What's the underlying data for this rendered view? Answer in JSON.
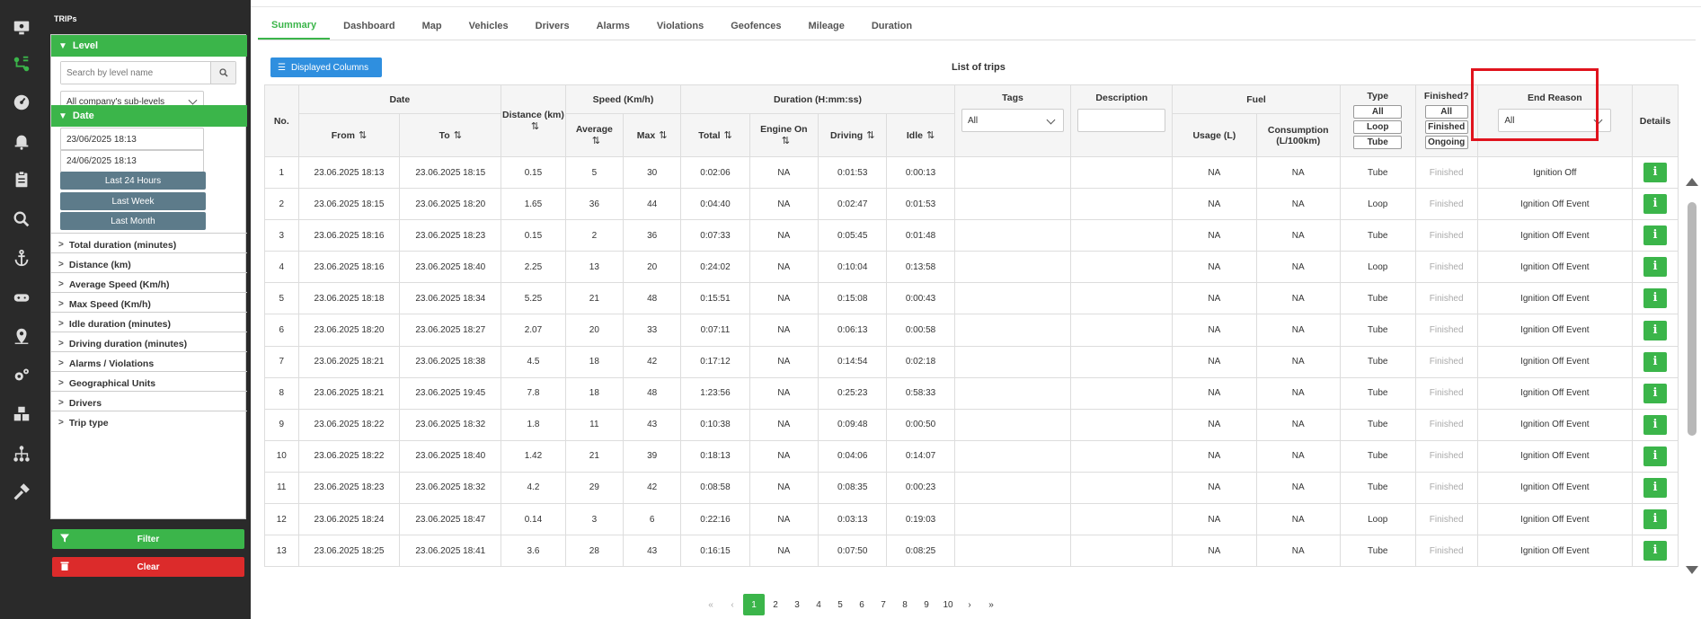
{
  "sidebar": {
    "icons": [
      "monitor-icon",
      "trips-route-icon",
      "dashboard-gauge-icon",
      "alarm-bell-icon",
      "clipboard-icon",
      "search-icon",
      "anchor-icon",
      "gamepad-icon",
      "location-pin-icon",
      "settings-gears-icon",
      "cubes-icon",
      "network-icon",
      "hammer-icon"
    ]
  },
  "panel": {
    "title": "TRIPs",
    "level_label": "Level",
    "search_placeholder": "Search by level name",
    "sublevel_select": "All company's sub-levels",
    "date_label": "Date",
    "date_from": "23/06/2025 18:13",
    "date_to": "24/06/2025 18:13",
    "quick": [
      "Last 24 Hours",
      "Last Week",
      "Last Month"
    ],
    "collapsed": [
      "Total duration (minutes)",
      "Distance (km)",
      "Average Speed (Km/h)",
      "Max Speed (Km/h)",
      "Idle duration (minutes)",
      "Driving duration (minutes)",
      "Alarms / Violations",
      "Geographical Units",
      "Drivers",
      "Trip type"
    ],
    "filter_label": "Filter",
    "clear_label": "Clear"
  },
  "tabs": [
    "Summary",
    "Dashboard",
    "Map",
    "Vehicles",
    "Drivers",
    "Alarms",
    "Violations",
    "Geofences",
    "Mileage",
    "Duration"
  ],
  "displayed_columns": "Displayed Columns",
  "list_title": "List of trips",
  "headers": {
    "no": "No.",
    "date": "Date",
    "from": "From",
    "to": "To",
    "distance": "Distance (km)",
    "speed": "Speed (Km/h)",
    "average": "Average",
    "max": "Max",
    "duration": "Duration (H:mm:ss)",
    "total": "Total",
    "engine_on": "Engine On",
    "driving": "Driving",
    "idle": "Idle",
    "tags": "Tags",
    "tags_select": "All",
    "description": "Description",
    "fuel": "Fuel",
    "usage": "Usage (L)",
    "consumption": "Consumption (L/100km)",
    "type": "Type",
    "type_opts": [
      "All",
      "Loop",
      "Tube"
    ],
    "finished": "Finished?",
    "finished_opts": [
      "All",
      "Finished",
      "Ongoing"
    ],
    "end_reason": "End Reason",
    "end_reason_select": "All",
    "details": "Details",
    "sort_glyph": "⇅",
    "info_glyph": "i"
  },
  "rows": [
    {
      "no": "1",
      "from": "23.06.2025 18:13",
      "to": "23.06.2025 18:15",
      "distance": "0.15",
      "avg": "5",
      "max": "30",
      "total": "0:02:06",
      "engine": "NA",
      "driving": "0:01:53",
      "idle": "0:00:13",
      "usage": "NA",
      "consumption": "NA",
      "type": "Tube",
      "finished": "Finished",
      "reason": "Ignition Off"
    },
    {
      "no": "2",
      "from": "23.06.2025 18:15",
      "to": "23.06.2025 18:20",
      "distance": "1.65",
      "avg": "36",
      "max": "44",
      "total": "0:04:40",
      "engine": "NA",
      "driving": "0:02:47",
      "idle": "0:01:53",
      "usage": "NA",
      "consumption": "NA",
      "type": "Loop",
      "finished": "Finished",
      "reason": "Ignition Off Event"
    },
    {
      "no": "3",
      "from": "23.06.2025 18:16",
      "to": "23.06.2025 18:23",
      "distance": "0.15",
      "avg": "2",
      "max": "36",
      "total": "0:07:33",
      "engine": "NA",
      "driving": "0:05:45",
      "idle": "0:01:48",
      "usage": "NA",
      "consumption": "NA",
      "type": "Tube",
      "finished": "Finished",
      "reason": "Ignition Off Event"
    },
    {
      "no": "4",
      "from": "23.06.2025 18:16",
      "to": "23.06.2025 18:40",
      "distance": "2.25",
      "avg": "13",
      "max": "20",
      "total": "0:24:02",
      "engine": "NA",
      "driving": "0:10:04",
      "idle": "0:13:58",
      "usage": "NA",
      "consumption": "NA",
      "type": "Loop",
      "finished": "Finished",
      "reason": "Ignition Off Event"
    },
    {
      "no": "5",
      "from": "23.06.2025 18:18",
      "to": "23.06.2025 18:34",
      "distance": "5.25",
      "avg": "21",
      "max": "48",
      "total": "0:15:51",
      "engine": "NA",
      "driving": "0:15:08",
      "idle": "0:00:43",
      "usage": "NA",
      "consumption": "NA",
      "type": "Tube",
      "finished": "Finished",
      "reason": "Ignition Off Event"
    },
    {
      "no": "6",
      "from": "23.06.2025 18:20",
      "to": "23.06.2025 18:27",
      "distance": "2.07",
      "avg": "20",
      "max": "33",
      "total": "0:07:11",
      "engine": "NA",
      "driving": "0:06:13",
      "idle": "0:00:58",
      "usage": "NA",
      "consumption": "NA",
      "type": "Tube",
      "finished": "Finished",
      "reason": "Ignition Off Event"
    },
    {
      "no": "7",
      "from": "23.06.2025 18:21",
      "to": "23.06.2025 18:38",
      "distance": "4.5",
      "avg": "18",
      "max": "42",
      "total": "0:17:12",
      "engine": "NA",
      "driving": "0:14:54",
      "idle": "0:02:18",
      "usage": "NA",
      "consumption": "NA",
      "type": "Tube",
      "finished": "Finished",
      "reason": "Ignition Off Event"
    },
    {
      "no": "8",
      "from": "23.06.2025 18:21",
      "to": "23.06.2025 19:45",
      "distance": "7.8",
      "avg": "18",
      "max": "48",
      "total": "1:23:56",
      "engine": "NA",
      "driving": "0:25:23",
      "idle": "0:58:33",
      "usage": "NA",
      "consumption": "NA",
      "type": "Tube",
      "finished": "Finished",
      "reason": "Ignition Off Event"
    },
    {
      "no": "9",
      "from": "23.06.2025 18:22",
      "to": "23.06.2025 18:32",
      "distance": "1.8",
      "avg": "11",
      "max": "43",
      "total": "0:10:38",
      "engine": "NA",
      "driving": "0:09:48",
      "idle": "0:00:50",
      "usage": "NA",
      "consumption": "NA",
      "type": "Tube",
      "finished": "Finished",
      "reason": "Ignition Off Event"
    },
    {
      "no": "10",
      "from": "23.06.2025 18:22",
      "to": "23.06.2025 18:40",
      "distance": "1.42",
      "avg": "21",
      "max": "39",
      "total": "0:18:13",
      "engine": "NA",
      "driving": "0:04:06",
      "idle": "0:14:07",
      "usage": "NA",
      "consumption": "NA",
      "type": "Tube",
      "finished": "Finished",
      "reason": "Ignition Off Event"
    },
    {
      "no": "11",
      "from": "23.06.2025 18:23",
      "to": "23.06.2025 18:32",
      "distance": "4.2",
      "avg": "29",
      "max": "42",
      "total": "0:08:58",
      "engine": "NA",
      "driving": "0:08:35",
      "idle": "0:00:23",
      "usage": "NA",
      "consumption": "NA",
      "type": "Tube",
      "finished": "Finished",
      "reason": "Ignition Off Event"
    },
    {
      "no": "12",
      "from": "23.06.2025 18:24",
      "to": "23.06.2025 18:47",
      "distance": "0.14",
      "avg": "3",
      "max": "6",
      "total": "0:22:16",
      "engine": "NA",
      "driving": "0:03:13",
      "idle": "0:19:03",
      "usage": "NA",
      "consumption": "NA",
      "type": "Loop",
      "finished": "Finished",
      "reason": "Ignition Off Event"
    },
    {
      "no": "13",
      "from": "23.06.2025 18:25",
      "to": "23.06.2025 18:41",
      "distance": "3.6",
      "avg": "28",
      "max": "43",
      "total": "0:16:15",
      "engine": "NA",
      "driving": "0:07:50",
      "idle": "0:08:25",
      "usage": "NA",
      "consumption": "NA",
      "type": "Tube",
      "finished": "Finished",
      "reason": "Ignition Off Event"
    }
  ],
  "pagination": {
    "first": "«",
    "prev": "‹",
    "pages": [
      "1",
      "2",
      "3",
      "4",
      "5",
      "6",
      "7",
      "8",
      "9",
      "10"
    ],
    "next": "›",
    "last": "»"
  },
  "colors": {
    "green": "#3bb54a",
    "blue": "#2f8fdf",
    "red": "#dc2b2b",
    "slate": "#5d7b8a",
    "highlight": "#e0131d"
  }
}
